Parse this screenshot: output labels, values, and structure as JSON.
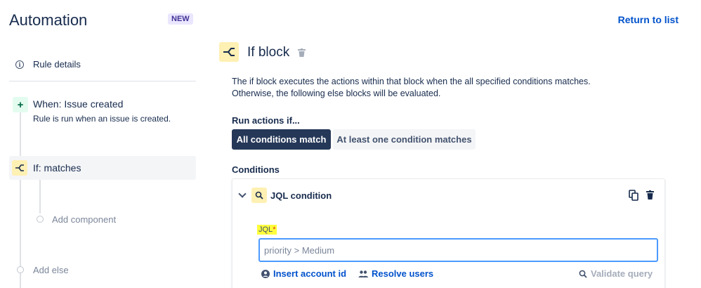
{
  "header": {
    "app_title": "Automation",
    "badge": "NEW",
    "return_link": "Return to list"
  },
  "sidebar": {
    "rule_details": "Rule details",
    "trigger": {
      "title": "When: Issue created",
      "description": "Rule is run when an issue is created."
    },
    "if_item": "If: matches",
    "add_component": "Add component",
    "add_else": "Add else"
  },
  "main": {
    "block_title": "If block",
    "description_line1": "The if block executes the actions within that block when the all specified conditions matches.",
    "description_line2": "Otherwise, the following else blocks will be evaluated.",
    "run_actions_label": "Run actions if...",
    "options": [
      "All conditions match",
      "At least one condition matches"
    ],
    "selected_option": "All conditions match",
    "conditions_label": "Conditions",
    "condition": {
      "title": "JQL condition",
      "field_label": "JQL",
      "required_mark": "*",
      "placeholder": "priority > Medium",
      "value": "",
      "insert_account": "Insert account id",
      "resolve_users": "Resolve users",
      "validate_query": "Validate query"
    }
  },
  "colors": {
    "brand_blue": "#0052cc",
    "dark_button": "#253858",
    "if_icon_bg": "#fff0b3",
    "trigger_icon_bg": "#e3fcef",
    "focus_border": "#4c9aff",
    "highlight": "#ffff3c"
  },
  "icons": [
    "info-icon",
    "plus-icon",
    "branch-icon",
    "trash-icon",
    "chevron-down-icon",
    "search-icon",
    "copy-icon",
    "user-icon",
    "users-icon"
  ]
}
